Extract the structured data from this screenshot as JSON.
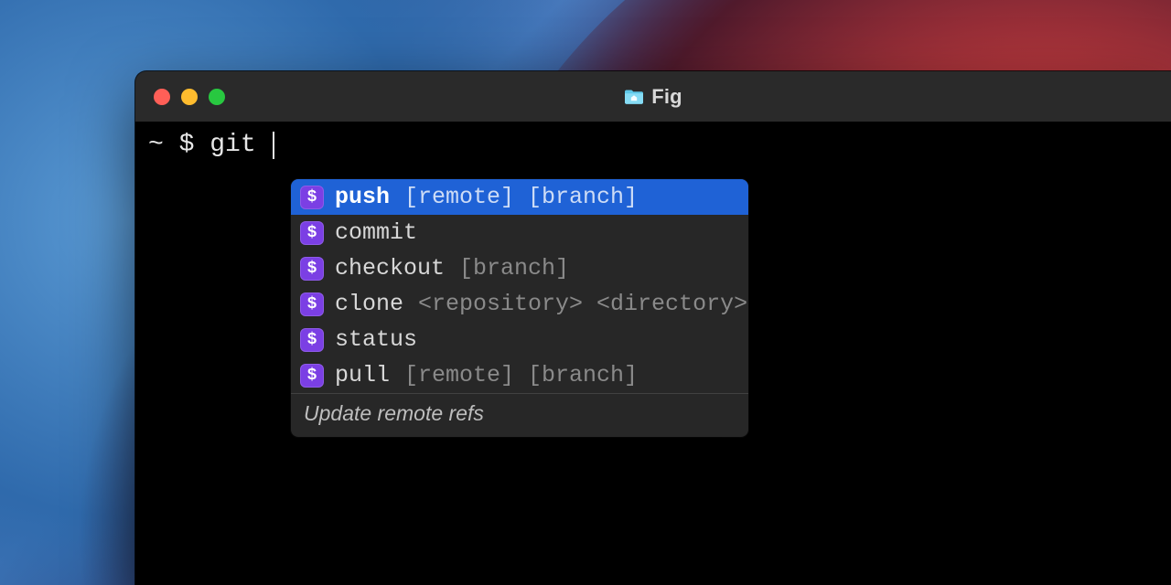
{
  "window": {
    "title": "Fig"
  },
  "prompt": {
    "prefix": "~ $ ",
    "typed": "git "
  },
  "autocomplete": {
    "items": [
      {
        "name": "push",
        "args": "[remote] [branch]",
        "selected": true
      },
      {
        "name": "commit",
        "args": "",
        "selected": false
      },
      {
        "name": "checkout",
        "args": "[branch]",
        "selected": false
      },
      {
        "name": "clone",
        "args": "<repository> <directory>",
        "selected": false
      },
      {
        "name": "status",
        "args": "",
        "selected": false
      },
      {
        "name": "pull",
        "args": "[remote] [branch]",
        "selected": false
      }
    ],
    "description": "Update remote refs"
  }
}
